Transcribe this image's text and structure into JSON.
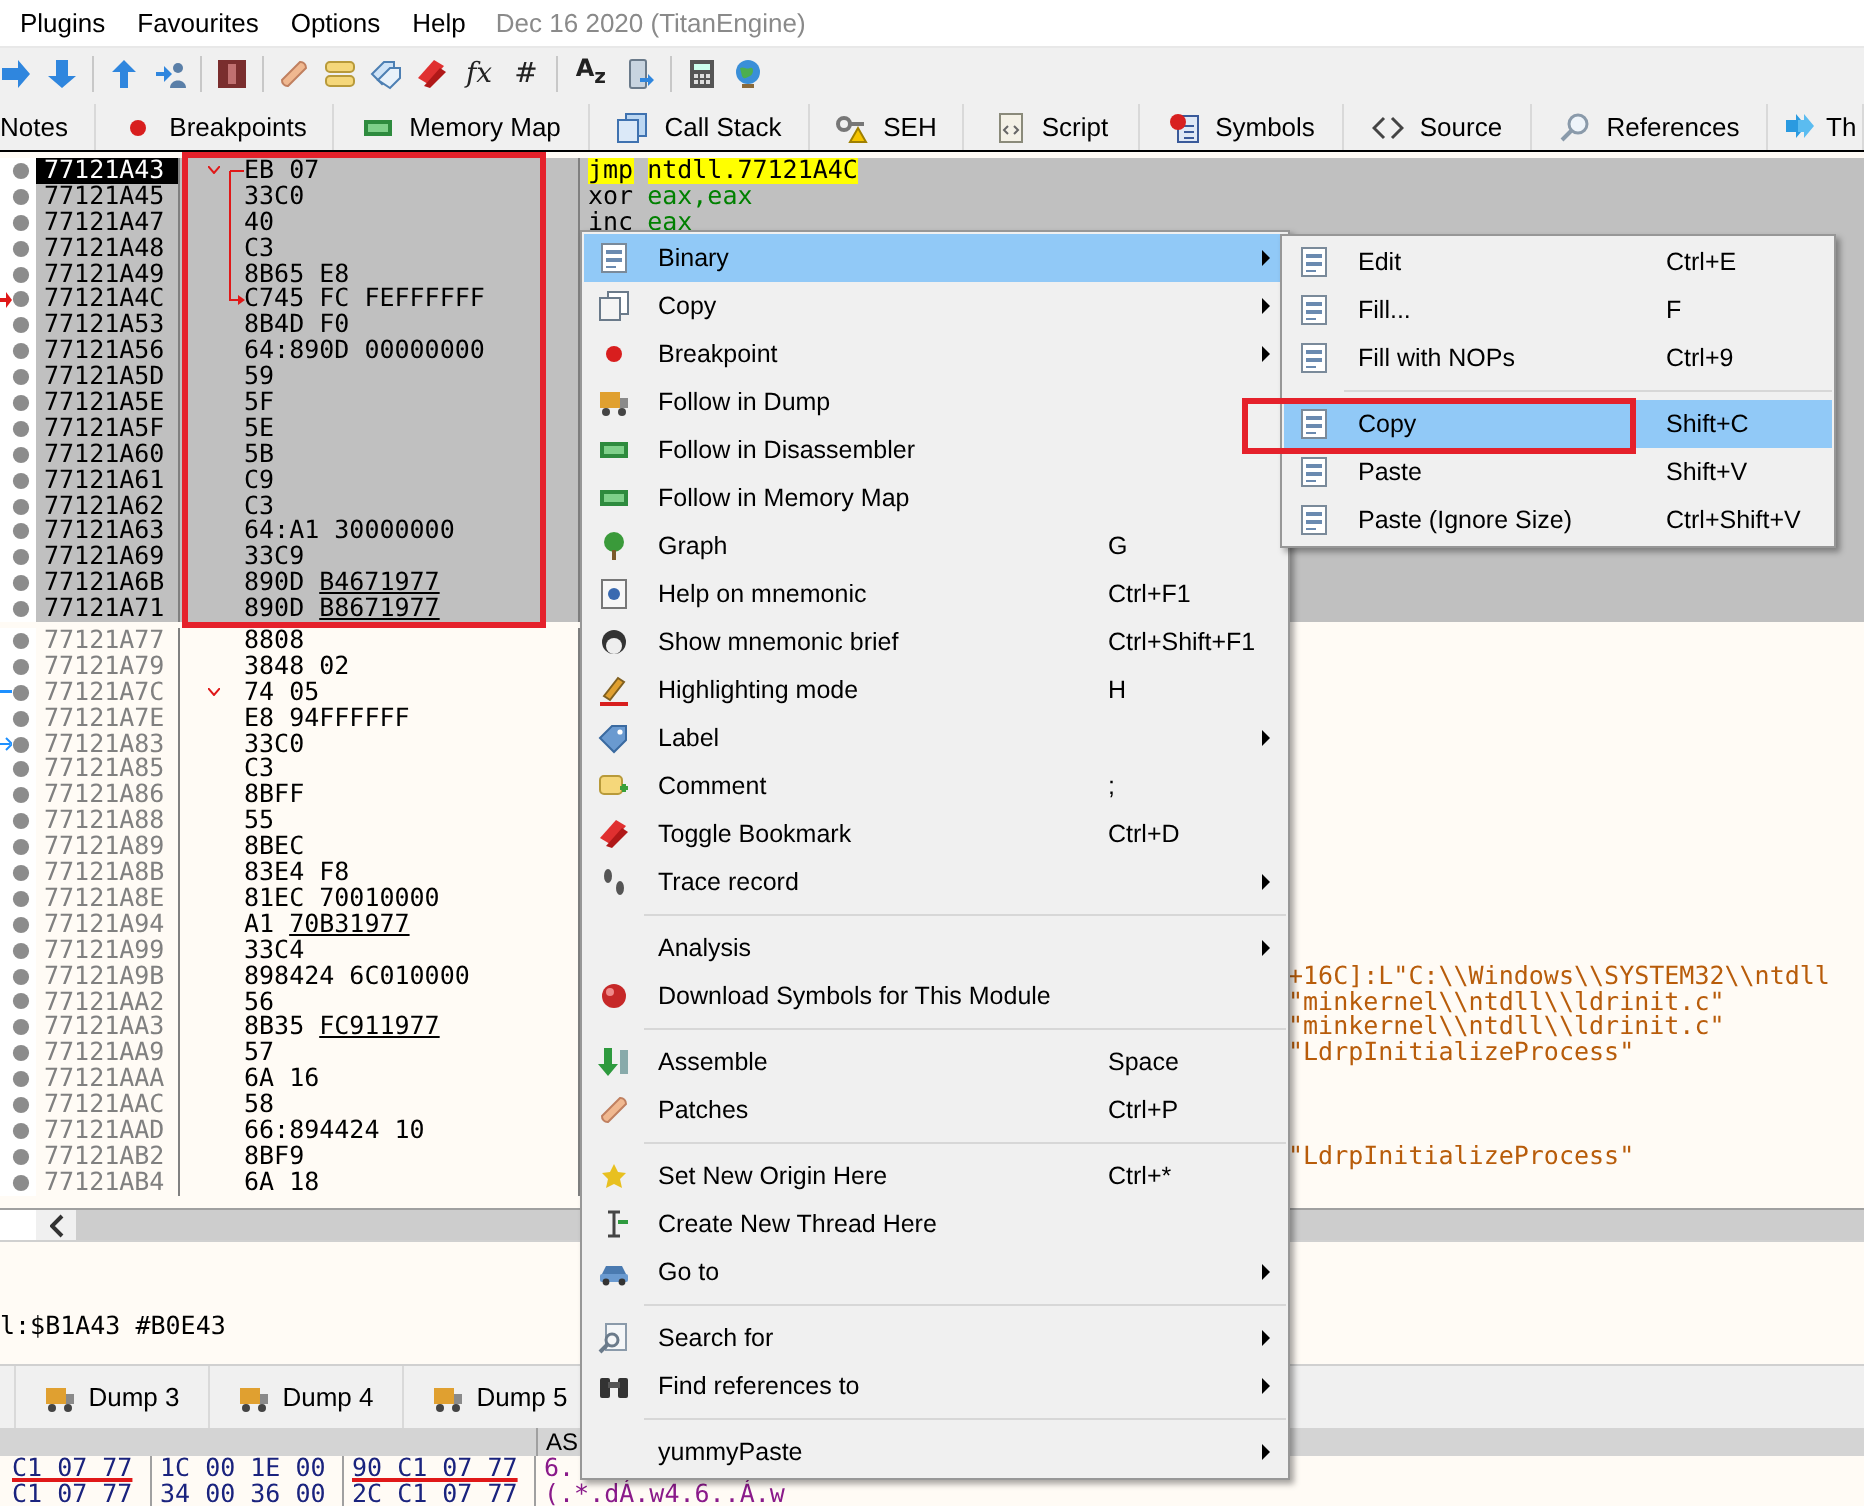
{
  "menubar": {
    "items": [
      "Plugins",
      "Favourites",
      "Options",
      "Help"
    ],
    "build": "Dec 16 2020 (TitanEngine)"
  },
  "toolbar": {
    "glyphs": [
      "fx",
      "#",
      "A$_{z}$"
    ]
  },
  "tabs": [
    {
      "label": "Notes",
      "selected": false
    },
    {
      "label": "Breakpoints",
      "selected": false
    },
    {
      "label": "Memory Map",
      "selected": false
    },
    {
      "label": "Call Stack",
      "selected": false
    },
    {
      "label": "SEH",
      "selected": false
    },
    {
      "label": "Script",
      "selected": false
    },
    {
      "label": "Symbols",
      "selected": false
    },
    {
      "label": "Source",
      "selected": false
    },
    {
      "label": "References",
      "selected": false
    },
    {
      "label": "Th",
      "selected": false
    }
  ],
  "disassembly": {
    "rows": [
      {
        "address": "77121A43",
        "bytes": "EB 07",
        "selected": true,
        "current": true,
        "branch_caret": true,
        "instruction": {
          "mnemonic": "jmp",
          "operands": "ntdll.77121A4C",
          "highlighted": true
        }
      },
      {
        "address": "77121A45",
        "bytes": "33C0",
        "selected": true,
        "current": false,
        "instruction": {
          "mnemonic": "xor",
          "operands": "eax,eax",
          "highlighted": false
        }
      },
      {
        "address": "77121A47",
        "bytes": "40",
        "selected": true,
        "current": false,
        "instruction": {
          "mnemonic": "inc",
          "operands": "eax",
          "highlighted": false
        }
      },
      {
        "address": "77121A48",
        "bytes": "C3",
        "selected": true,
        "current": false
      },
      {
        "address": "77121A49",
        "bytes": "8B65 E8",
        "selected": true,
        "current": false
      },
      {
        "address": "77121A4C",
        "bytes": "C745 FC FEFFFFFF",
        "selected": true,
        "current": false,
        "branch_target": true,
        "gutter_arrow": true
      },
      {
        "address": "77121A53",
        "bytes": "8B4D F0",
        "selected": true,
        "current": false
      },
      {
        "address": "77121A56",
        "bytes": "64:890D 00000000",
        "selected": true,
        "current": false
      },
      {
        "address": "77121A5D",
        "bytes": "59",
        "selected": true,
        "current": false
      },
      {
        "address": "77121A5E",
        "bytes": "5F",
        "selected": true,
        "current": false
      },
      {
        "address": "77121A5F",
        "bytes": "5E",
        "selected": true,
        "current": false
      },
      {
        "address": "77121A60",
        "bytes": "5B",
        "selected": true,
        "current": false
      },
      {
        "address": "77121A61",
        "bytes": "C9",
        "selected": true,
        "current": false
      },
      {
        "address": "77121A62",
        "bytes": "C3",
        "selected": true,
        "current": false
      },
      {
        "address": "77121A63",
        "bytes": "64:A1 30000000",
        "selected": true,
        "current": false
      },
      {
        "address": "77121A69",
        "bytes": "33C9",
        "selected": true,
        "current": false
      },
      {
        "address": "77121A6B",
        "bytes": "890D",
        "bytes_ref": "B4671977",
        "selected": true,
        "current": false
      },
      {
        "address": "77121A71",
        "bytes": "890D",
        "bytes_ref": "B8671977",
        "selected": true,
        "current": false
      },
      {
        "address": "77121A77",
        "bytes": "8808",
        "selected": false,
        "current": false
      },
      {
        "address": "77121A79",
        "bytes": "3848 02",
        "selected": false,
        "current": false
      },
      {
        "address": "77121A7C",
        "bytes": "74 05",
        "selected": false,
        "current": false,
        "branch_caret": true,
        "jump_out": true
      },
      {
        "address": "77121A7E",
        "bytes": "E8 94FFFFFF",
        "selected": false,
        "current": false
      },
      {
        "address": "77121A83",
        "bytes": "33C0",
        "selected": false,
        "current": false,
        "jump_in": true
      },
      {
        "address": "77121A85",
        "bytes": "C3",
        "selected": false,
        "current": false
      },
      {
        "address": "77121A86",
        "bytes": "8BFF",
        "selected": false,
        "current": false
      },
      {
        "address": "77121A88",
        "bytes": "55",
        "selected": false,
        "current": false
      },
      {
        "address": "77121A89",
        "bytes": "8BEC",
        "selected": false,
        "current": false
      },
      {
        "address": "77121A8B",
        "bytes": "83E4 F8",
        "selected": false,
        "current": false
      },
      {
        "address": "77121A8E",
        "bytes": "81EC 70010000",
        "selected": false,
        "current": false
      },
      {
        "address": "77121A94",
        "bytes": "A1",
        "bytes_ref": "70B31977",
        "selected": false,
        "current": false
      },
      {
        "address": "77121A99",
        "bytes": "33C4",
        "selected": false,
        "current": false
      },
      {
        "address": "77121A9B",
        "bytes": "898424 6C010000",
        "selected": false,
        "current": false,
        "visible_tail": "+16C]:L\"C:\\\\Windows\\\\SYSTEM32\\\\ntdll"
      },
      {
        "address": "77121AA2",
        "bytes": "56",
        "selected": false,
        "current": false,
        "visible_tail": "\"minkernel\\\\ntdll\\\\ldrinit.c\""
      },
      {
        "address": "77121AA3",
        "bytes": "8B35",
        "bytes_ref": "FC911977",
        "selected": false,
        "current": false,
        "visible_tail": "\"minkernel\\\\ntdll\\\\ldrinit.c\""
      },
      {
        "address": "77121AA9",
        "bytes": "57",
        "selected": false,
        "current": false,
        "visible_tail": "\"LdrpInitializeProcess\""
      },
      {
        "address": "77121AAA",
        "bytes": "6A 16",
        "selected": false,
        "current": false
      },
      {
        "address": "77121AAC",
        "bytes": "58",
        "selected": false,
        "current": false
      },
      {
        "address": "77121AAD",
        "bytes": "66:894424 10",
        "selected": false,
        "current": false
      },
      {
        "address": "77121AB2",
        "bytes": "8BF9",
        "selected": false,
        "current": false,
        "visible_tail": "\"LdrpInitializeProcess\""
      },
      {
        "address": "77121AB4",
        "bytes": "6A 18",
        "selected": false,
        "current": false
      }
    ]
  },
  "info_line": "l:$B1A43 #B0E43",
  "dump_tabs": [
    {
      "label": "Dump 3",
      "selected": false
    },
    {
      "label": "Dump 4",
      "selected": false
    },
    {
      "label": "Dump 5",
      "selected": false
    }
  ],
  "dump": {
    "header": "AS",
    "rows": [
      {
        "groups": [
          {
            "text": "C1 07 77",
            "underlined": true
          },
          {
            "text": "1C 00 1E 00",
            "underlined": false
          },
          {
            "text": "90 C1 07 77",
            "underlined": true
          }
        ],
        "ascii": "6."
      },
      {
        "groups": [
          {
            "text": "C1 07 77",
            "underlined": false
          },
          {
            "text": "34 00 36 00",
            "underlined": false
          },
          {
            "text": "2C C1 07 77",
            "underlined": false
          }
        ],
        "ascii": "(.*.dÁ.w4.6..Á.w"
      }
    ]
  },
  "context_menu": {
    "items": [
      {
        "kind": "item",
        "label": "Binary",
        "submenu": true,
        "selected": true
      },
      {
        "kind": "item",
        "label": "Copy",
        "submenu": true,
        "selected": false
      },
      {
        "kind": "item",
        "label": "Breakpoint",
        "submenu": true,
        "selected": false
      },
      {
        "kind": "item",
        "label": "Follow in Dump",
        "submenu": false,
        "selected": false
      },
      {
        "kind": "item",
        "label": "Follow in Disassembler",
        "submenu": false,
        "selected": false
      },
      {
        "kind": "item",
        "label": "Follow in Memory Map",
        "submenu": false,
        "selected": false
      },
      {
        "kind": "item",
        "label": "Graph",
        "shortcut": "G",
        "submenu": false,
        "selected": false
      },
      {
        "kind": "item",
        "label": "Help on mnemonic",
        "shortcut": "Ctrl+F1",
        "submenu": false,
        "selected": false
      },
      {
        "kind": "item",
        "label": "Show mnemonic brief",
        "shortcut": "Ctrl+Shift+F1",
        "submenu": false,
        "selected": false
      },
      {
        "kind": "item",
        "label": "Highlighting mode",
        "shortcut": "H",
        "submenu": false,
        "selected": false
      },
      {
        "kind": "item",
        "label": "Label",
        "submenu": true,
        "selected": false
      },
      {
        "kind": "item",
        "label": "Comment",
        "shortcut": ";",
        "submenu": false,
        "selected": false
      },
      {
        "kind": "item",
        "label": "Toggle Bookmark",
        "shortcut": "Ctrl+D",
        "submenu": false,
        "selected": false
      },
      {
        "kind": "item",
        "label": "Trace record",
        "submenu": true,
        "selected": false
      },
      {
        "kind": "separator"
      },
      {
        "kind": "item",
        "label": "Analysis",
        "submenu": true,
        "selected": false
      },
      {
        "kind": "item",
        "label": "Download Symbols for This Module",
        "submenu": false,
        "selected": false
      },
      {
        "kind": "separator"
      },
      {
        "kind": "item",
        "label": "Assemble",
        "shortcut": "Space",
        "submenu": false,
        "selected": false
      },
      {
        "kind": "item",
        "label": "Patches",
        "shortcut": "Ctrl+P",
        "submenu": false,
        "selected": false
      },
      {
        "kind": "separator"
      },
      {
        "kind": "item",
        "label": "Set New Origin Here",
        "shortcut": "Ctrl+*",
        "submenu": false,
        "selected": false
      },
      {
        "kind": "item",
        "label": "Create New Thread Here",
        "submenu": false,
        "selected": false
      },
      {
        "kind": "item",
        "label": "Go to",
        "submenu": true,
        "selected": false
      },
      {
        "kind": "separator"
      },
      {
        "kind": "item",
        "label": "Search for",
        "submenu": true,
        "selected": false
      },
      {
        "kind": "item",
        "label": "Find references to",
        "submenu": true,
        "selected": false
      },
      {
        "kind": "separator"
      },
      {
        "kind": "item",
        "label": "yummyPaste",
        "submenu": true,
        "selected": false
      }
    ]
  },
  "submenu": {
    "items": [
      {
        "kind": "item",
        "label": "Edit",
        "shortcut": "Ctrl+E",
        "selected": false
      },
      {
        "kind": "item",
        "label": "Fill...",
        "shortcut": "F",
        "selected": false
      },
      {
        "kind": "item",
        "label": "Fill with NOPs",
        "shortcut": "Ctrl+9",
        "selected": false
      },
      {
        "kind": "separator"
      },
      {
        "kind": "item",
        "label": "Copy",
        "shortcut": "Shift+C",
        "selected": true
      },
      {
        "kind": "item",
        "label": "Paste",
        "shortcut": "Shift+V",
        "selected": false
      },
      {
        "kind": "item",
        "label": "Paste (Ignore Size)",
        "shortcut": "Ctrl+Shift+V",
        "selected": false
      }
    ]
  }
}
